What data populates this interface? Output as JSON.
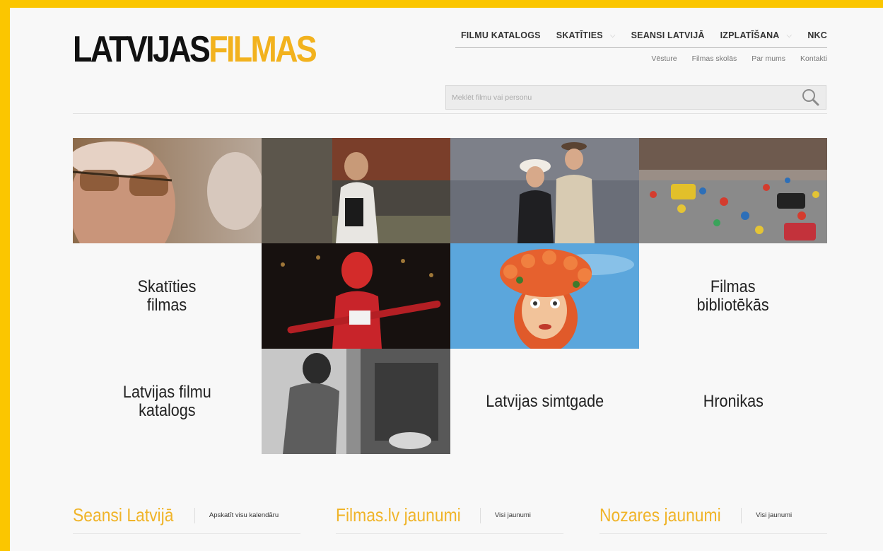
{
  "logo": {
    "part1": "LATVIJAS",
    "part2": "FILMAS"
  },
  "main_nav": [
    {
      "label": "FILMU KATALOGS",
      "dropdown": false
    },
    {
      "label": "SKATĪTIES",
      "dropdown": true
    },
    {
      "label": "SEANSI LATVIJĀ",
      "dropdown": false
    },
    {
      "label": "IZPLATĪŠANA",
      "dropdown": true
    },
    {
      "label": "NKC",
      "dropdown": false
    }
  ],
  "sub_nav": [
    "Vēsture",
    "Filmas skolās",
    "Par mums",
    "Kontakti"
  ],
  "search": {
    "placeholder": "Meklēt filmu vai personu"
  },
  "tiles": {
    "skatities": "Skatīties\nfilmas",
    "bibliotekas": "Filmas\nbibliotēkās",
    "katalogs": "Latvijas filmu\nkatalogs",
    "simtgade": "Latvijas simtgade",
    "hronikas": "Hronikas"
  },
  "sections": [
    {
      "title": "Seansi Latvijā",
      "link": "Apskatīt visu kalendāru"
    },
    {
      "title": "Filmas.lv jaunumi",
      "link": "Visi jaunumi"
    },
    {
      "title": "Nozares jaunumi",
      "link": "Visi jaunumi"
    }
  ],
  "colors": {
    "frame": "#fbc600",
    "accent": "#f2b21e",
    "background": "#f8f8f8"
  }
}
